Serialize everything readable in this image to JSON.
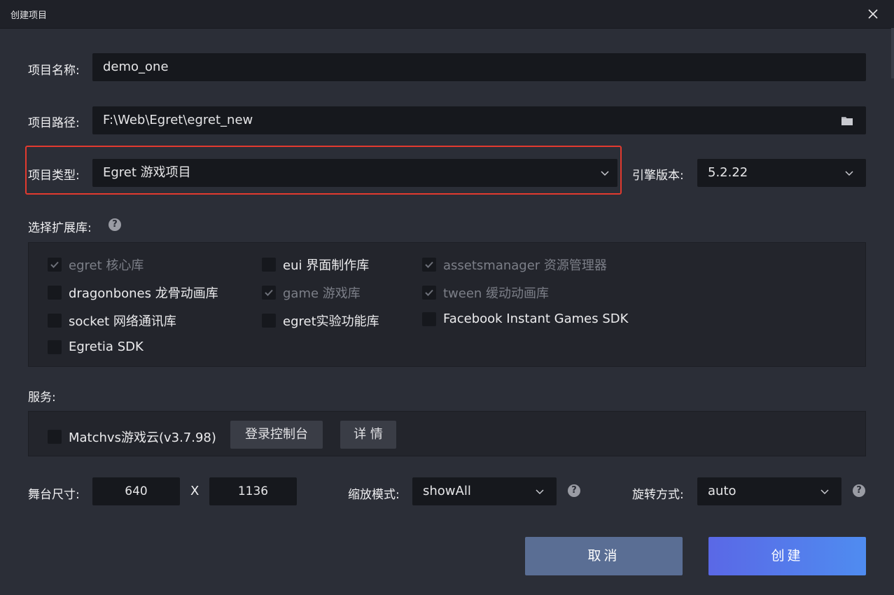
{
  "window": {
    "title": "创建项目"
  },
  "form": {
    "name_label": "项目名称:",
    "name_value": "demo_one",
    "path_label": "项目路径:",
    "path_value": "F:\\Web\\Egret\\egret_new",
    "type_label": "项目类型:",
    "type_value": "Egret 游戏项目",
    "engine_label": "引擎版本:",
    "engine_value": "5.2.22"
  },
  "libraries": {
    "label": "选择扩展库:",
    "items": [
      {
        "label": "egret 核心库",
        "checked": true,
        "disabled": true
      },
      {
        "label": "eui 界面制作库",
        "checked": false,
        "disabled": false
      },
      {
        "label": "assetsmanager 资源管理器",
        "checked": true,
        "disabled": true
      },
      {
        "label": "dragonbones 龙骨动画库",
        "checked": false,
        "disabled": false
      },
      {
        "label": "game 游戏库",
        "checked": true,
        "disabled": true
      },
      {
        "label": "tween 缓动动画库",
        "checked": true,
        "disabled": true
      },
      {
        "label": "socket 网络通讯库",
        "checked": false,
        "disabled": false
      },
      {
        "label": "egret实验功能库",
        "checked": false,
        "disabled": false
      },
      {
        "label": "Facebook Instant Games SDK",
        "checked": false,
        "disabled": false
      },
      {
        "label": "Egretia SDK",
        "checked": false,
        "disabled": false
      }
    ]
  },
  "services": {
    "label": "服务:",
    "matchvs_label": "Matchvs游戏云(v3.7.98)",
    "console_button": "登录控制台",
    "details_button": "详 情"
  },
  "stage": {
    "size_label": "舞台尺寸:",
    "width": "640",
    "separator": "X",
    "height": "1136",
    "scale_label": "缩放模式:",
    "scale_value": "showAll",
    "rotate_label": "旋转方式:",
    "rotate_value": "auto"
  },
  "actions": {
    "cancel_label": "取消",
    "create_label": "创建"
  },
  "colors": {
    "background": "#2b2e37",
    "input_bg": "#16181d",
    "highlight": "#e23a2f",
    "cancel_bg": "#5a6e94",
    "create_gradient_start": "#5a68e6",
    "create_gradient_end": "#4f8cf0"
  }
}
